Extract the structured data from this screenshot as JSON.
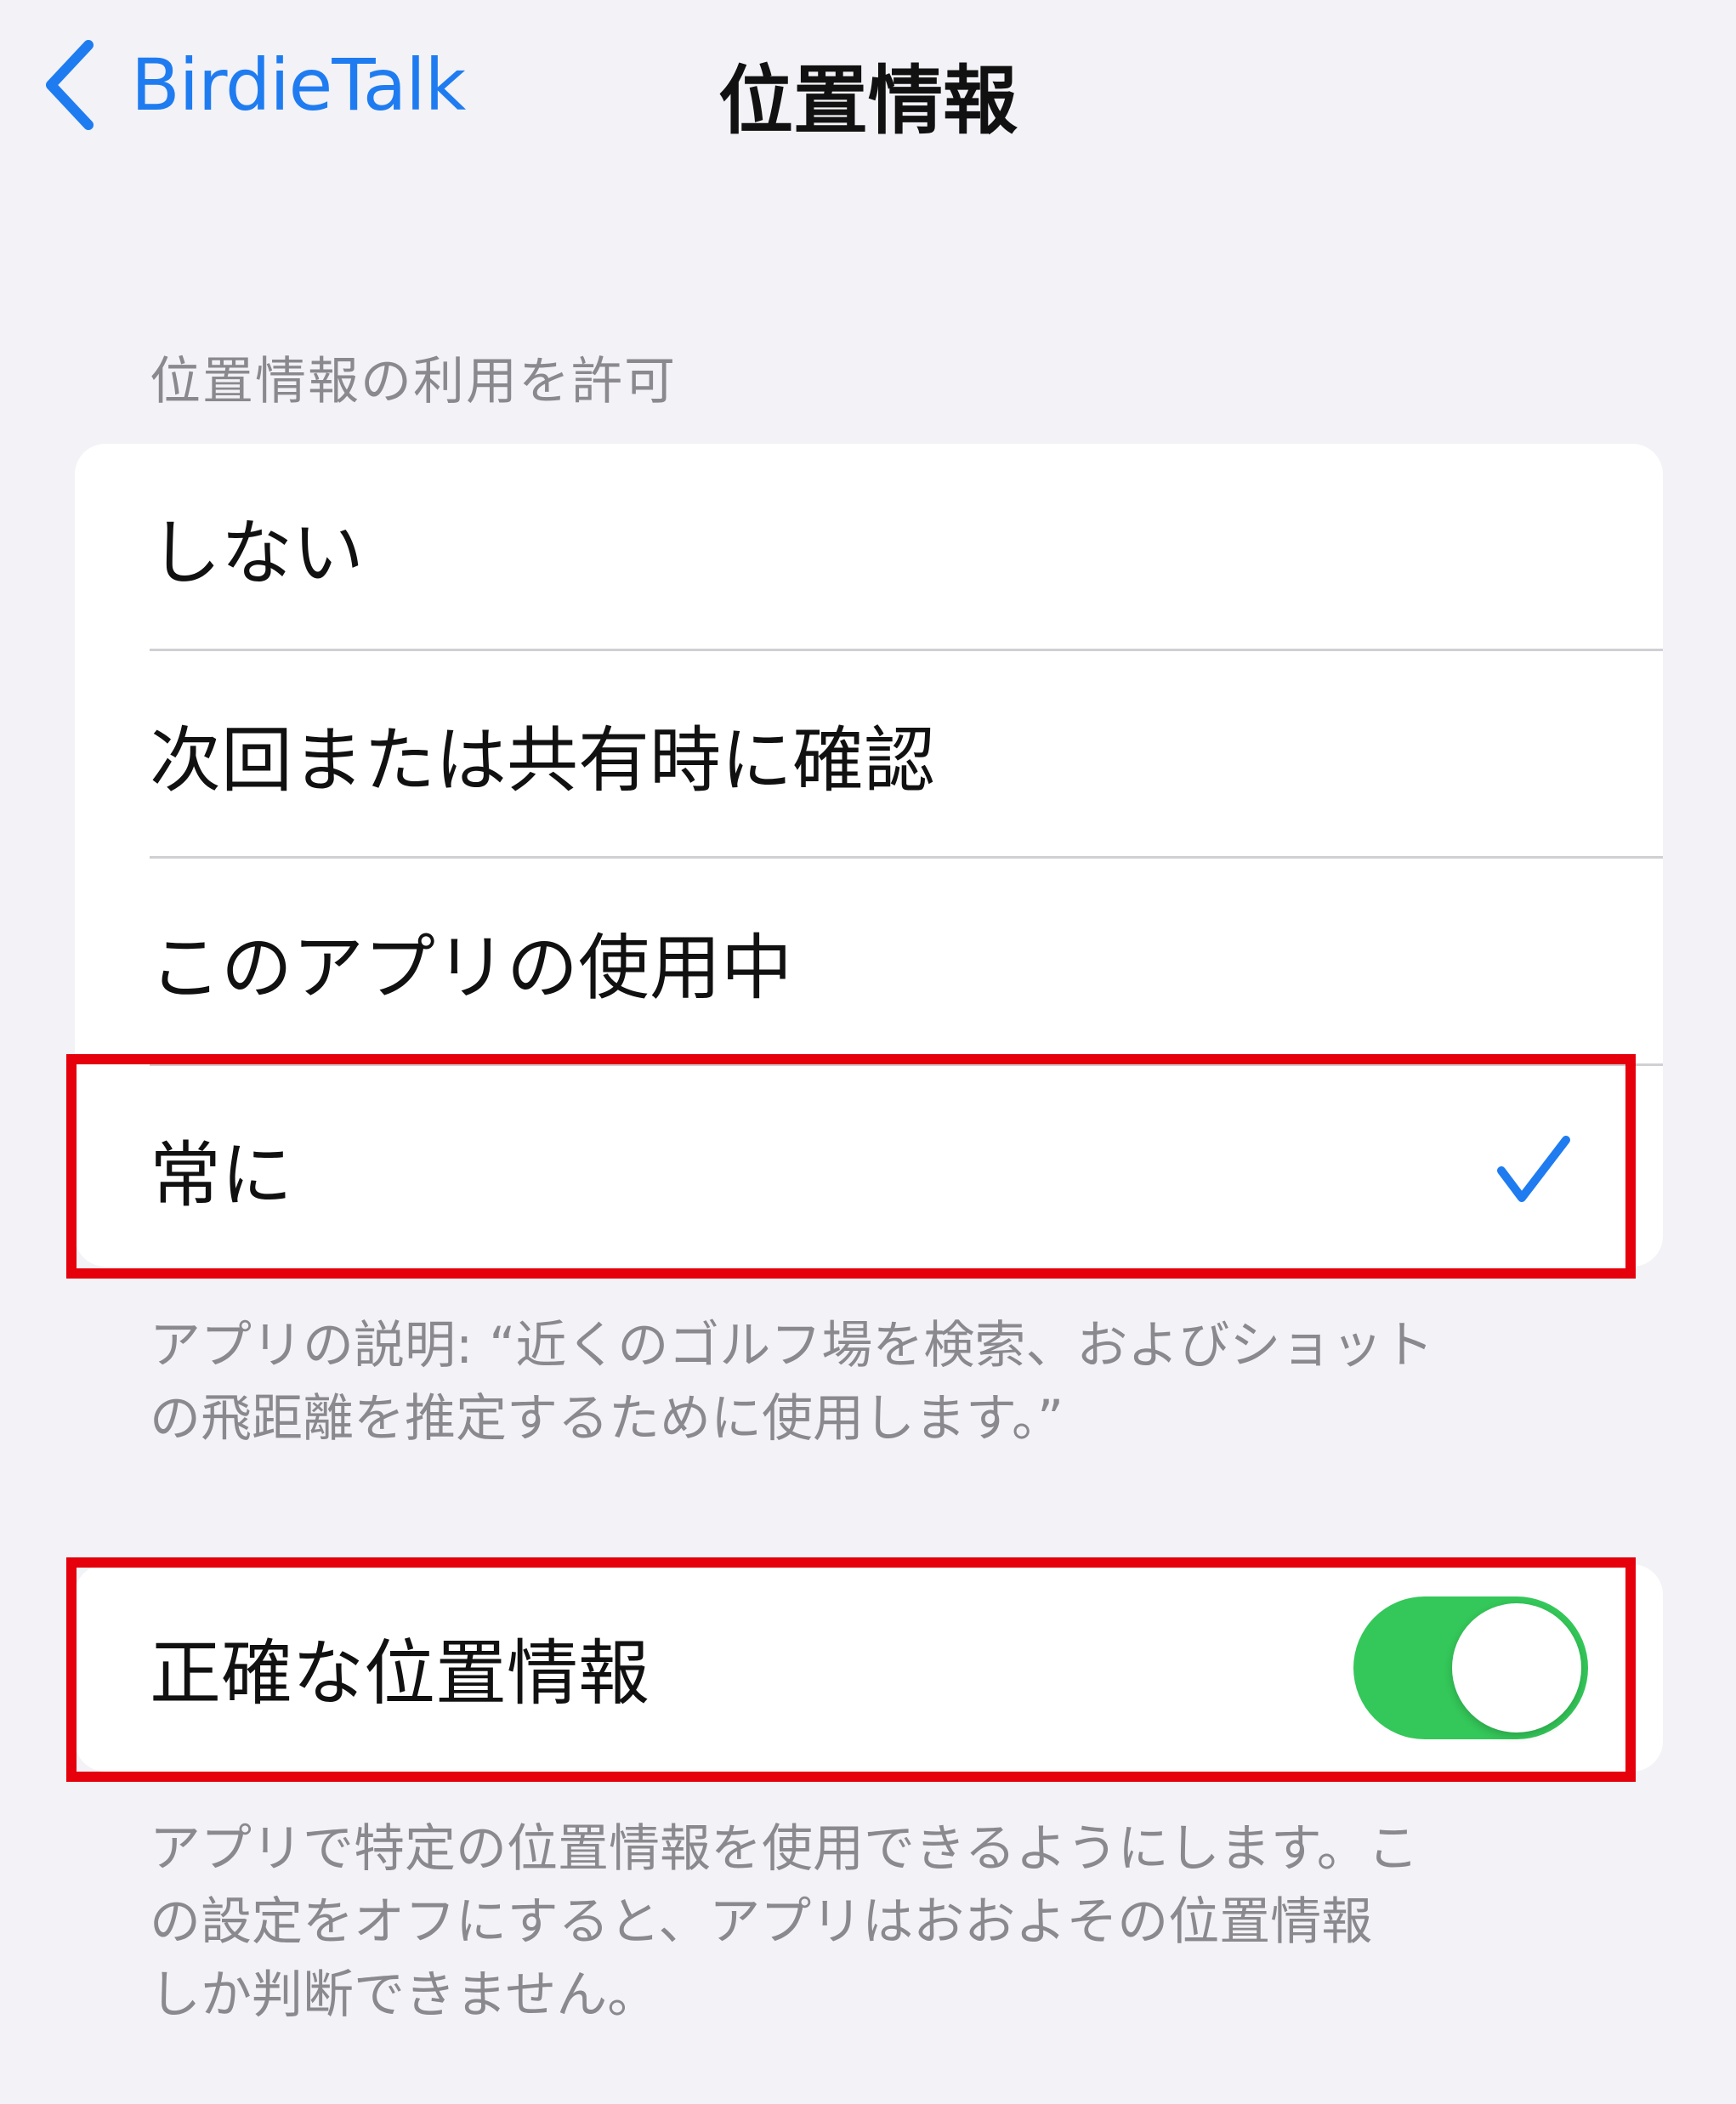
{
  "nav": {
    "back_label": "BirdieTalk",
    "title": "位置情報"
  },
  "permission_section": {
    "header": "位置情報の利用を許可",
    "options": [
      {
        "label": "しない",
        "selected": false
      },
      {
        "label": "次回または共有時に確認",
        "selected": false
      },
      {
        "label": "このアプリの使用中",
        "selected": false
      },
      {
        "label": "常に",
        "selected": true
      }
    ],
    "footer_line1": "アプリの説明: “近くのゴルフ場を検索、およびショット",
    "footer_line2": "の飛距離を推定するために使用します。”"
  },
  "precise_section": {
    "label": "正確な位置情報",
    "toggle_on": true,
    "footer_line1": "アプリで特定の位置情報を使用できるようにします。こ",
    "footer_line2": "の設定をオフにすると、アプリはおおよその位置情報",
    "footer_line3": "しか判断できません。"
  },
  "colors": {
    "accent": "#1f7cf0",
    "toggle_on": "#34c759",
    "highlight": "#e5000b",
    "background": "#f2f2f7"
  }
}
